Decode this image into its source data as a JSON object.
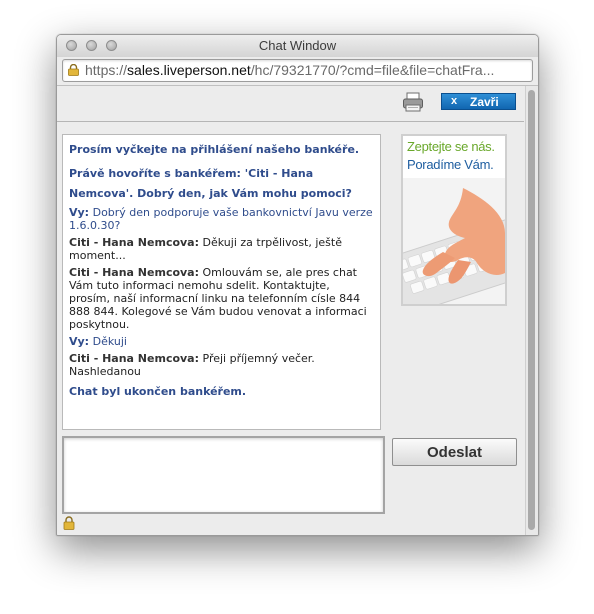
{
  "window": {
    "title": "Chat Window",
    "url_prefix": "https://",
    "url_host": "sales.liveperson.net",
    "url_rest": "/hc/79321770/?cmd=file&file=chatFra..."
  },
  "toolbar": {
    "close_x": "x",
    "close_label": "Zavři",
    "accent_color": "#1a75c1"
  },
  "transcript": {
    "messages": [
      {
        "kind": "system",
        "text": "Prosím vyčkejte na přihlášení našeho bankéře."
      },
      {
        "kind": "system",
        "text": "Právě hovoříte s bankéřem: 'Citi - Hana Nemcova'. Dobrý den, jak Vám mohu pomoci?"
      },
      {
        "kind": "user",
        "name": "Vy:",
        "text": "Dobrý den podporuje vaše bankovnictví Javu verze 1.6.0.30?"
      },
      {
        "kind": "agent",
        "name": "Citi - Hana Nemcova:",
        "text": "Děkuji za trpělivost, ještě moment..."
      },
      {
        "kind": "agent",
        "name": "Citi - Hana Nemcova:",
        "text": "Omlouvám se, ale pres chat Vám tuto informaci nemohu sdelit. Kontaktujte, prosím, naší informacní linku na telefonním císle 844 888 844. Kolegové se Vám budou venovat a informaci poskytnou."
      },
      {
        "kind": "user",
        "name": "Vy:",
        "text": "Děkuji"
      },
      {
        "kind": "agent",
        "name": "Citi - Hana Nemcova:",
        "text": "Přeji příjemný večer. Nashledanou"
      },
      {
        "kind": "system",
        "text": "Chat byl ukončen bankéřem."
      }
    ]
  },
  "ad": {
    "line1": "Zeptejte se nás.",
    "line2": "Poradíme Vám."
  },
  "composer": {
    "value": "",
    "send_label": "Odeslat"
  },
  "icons": {
    "url_lock": "lock-icon",
    "print": "printer-icon",
    "status": "lock-icon"
  }
}
